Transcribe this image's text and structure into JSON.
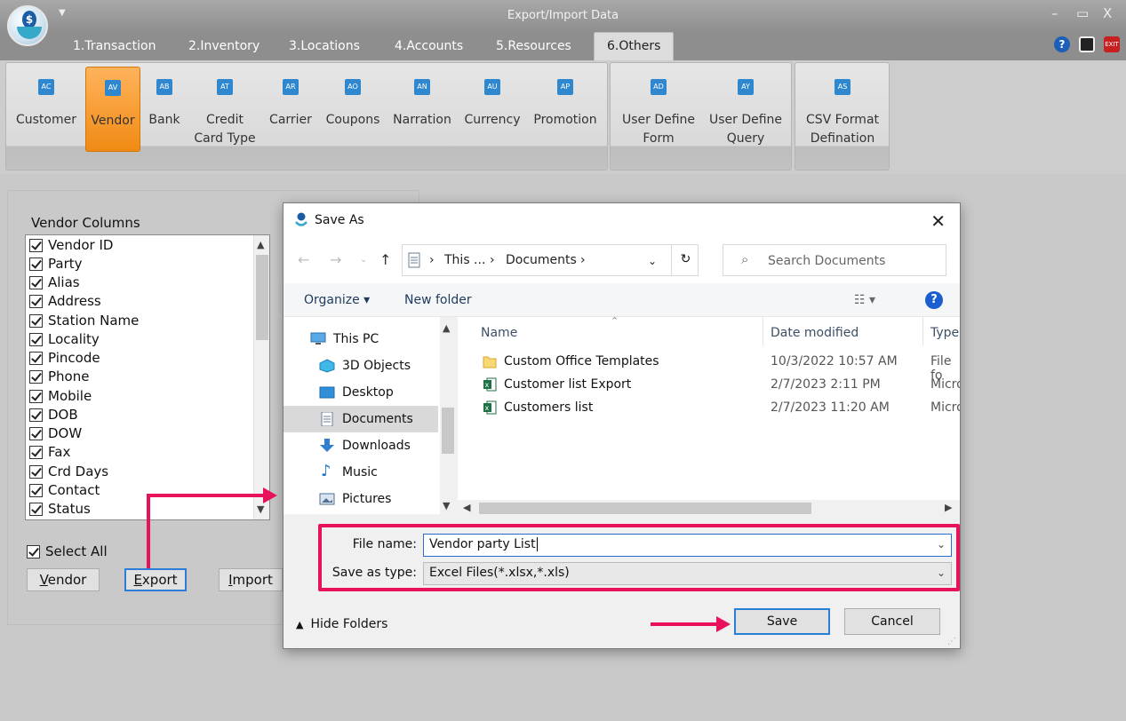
{
  "app": {
    "title": "Export/Import Data",
    "window_controls": [
      "–",
      "▭",
      "X"
    ]
  },
  "menu_tabs": [
    "1.Transaction",
    "2.Inventory",
    "3.Locations",
    "4.Accounts",
    "5.Resources",
    "6.Others"
  ],
  "ribbon": {
    "buttons": [
      {
        "label": "Customer",
        "icon": "AC"
      },
      {
        "label": "Vendor",
        "icon": "AV"
      },
      {
        "label": "Bank",
        "icon": "AB"
      },
      {
        "label": "Credit\nCard Type",
        "icon": "AT"
      },
      {
        "label": "Carrier",
        "icon": "AR"
      },
      {
        "label": "Coupons",
        "icon": "AO"
      },
      {
        "label": "Narration",
        "icon": "AN"
      },
      {
        "label": "Currency",
        "icon": "AU"
      },
      {
        "label": "Promotion",
        "icon": "AP"
      },
      {
        "label": "User Define\nForm",
        "icon": "AD"
      },
      {
        "label": "User Define\nQuery",
        "icon": "AY"
      },
      {
        "label": "CSV Format\nDefination",
        "icon": "AS"
      }
    ]
  },
  "vendor_panel": {
    "title": "Vendor Columns",
    "columns": [
      "Vendor ID",
      "Party",
      "Alias",
      "Address",
      "Station Name",
      "Locality",
      "Pincode",
      "Phone",
      "Mobile",
      "DOB",
      "DOW",
      "Fax",
      "Crd Days",
      "Contact",
      "Status"
    ],
    "select_all": "Select All",
    "btn_vendor_pre": "",
    "btn_vendor_ul": "V",
    "btn_vendor_post": "endor",
    "btn_export_pre": "",
    "btn_export_ul": "E",
    "btn_export_post": "xport",
    "btn_import_pre": "",
    "btn_import_ul": "I",
    "btn_import_post": "mport"
  },
  "dialog": {
    "title": "Save As",
    "close": "✕",
    "breadcrumb": [
      "This ...",
      "Documents"
    ],
    "search_placeholder": "Search Documents",
    "organize": "Organize ▾",
    "new_folder": "New folder",
    "nav": [
      "This PC",
      "3D Objects",
      "Desktop",
      "Documents",
      "Downloads",
      "Music",
      "Pictures"
    ],
    "headers": {
      "name": "Name",
      "date": "Date modified",
      "type": "Type"
    },
    "files": [
      {
        "name": "Custom Office Templates",
        "date": "10/3/2022 10:57 AM",
        "type": "File fo",
        "kind": "folder"
      },
      {
        "name": "Customer  list Export",
        "date": "2/7/2023 2:11 PM",
        "type": "Micro",
        "kind": "excel"
      },
      {
        "name": "Customers list",
        "date": "2/7/2023 11:20 AM",
        "type": "Micro",
        "kind": "excel"
      }
    ],
    "file_name_label": "File name:",
    "file_name_value": "Vendor  party List",
    "save_type_label": "Save as type:",
    "save_type_value": "Excel Files(*.xlsx,*.xls)",
    "hide_folders": "Hide Folders",
    "save": "Save",
    "cancel": "Cancel"
  },
  "colors": {
    "accent_orange": "#f08a14",
    "highlight_pink": "#e8125c",
    "focus_blue": "#2a7ed6"
  }
}
